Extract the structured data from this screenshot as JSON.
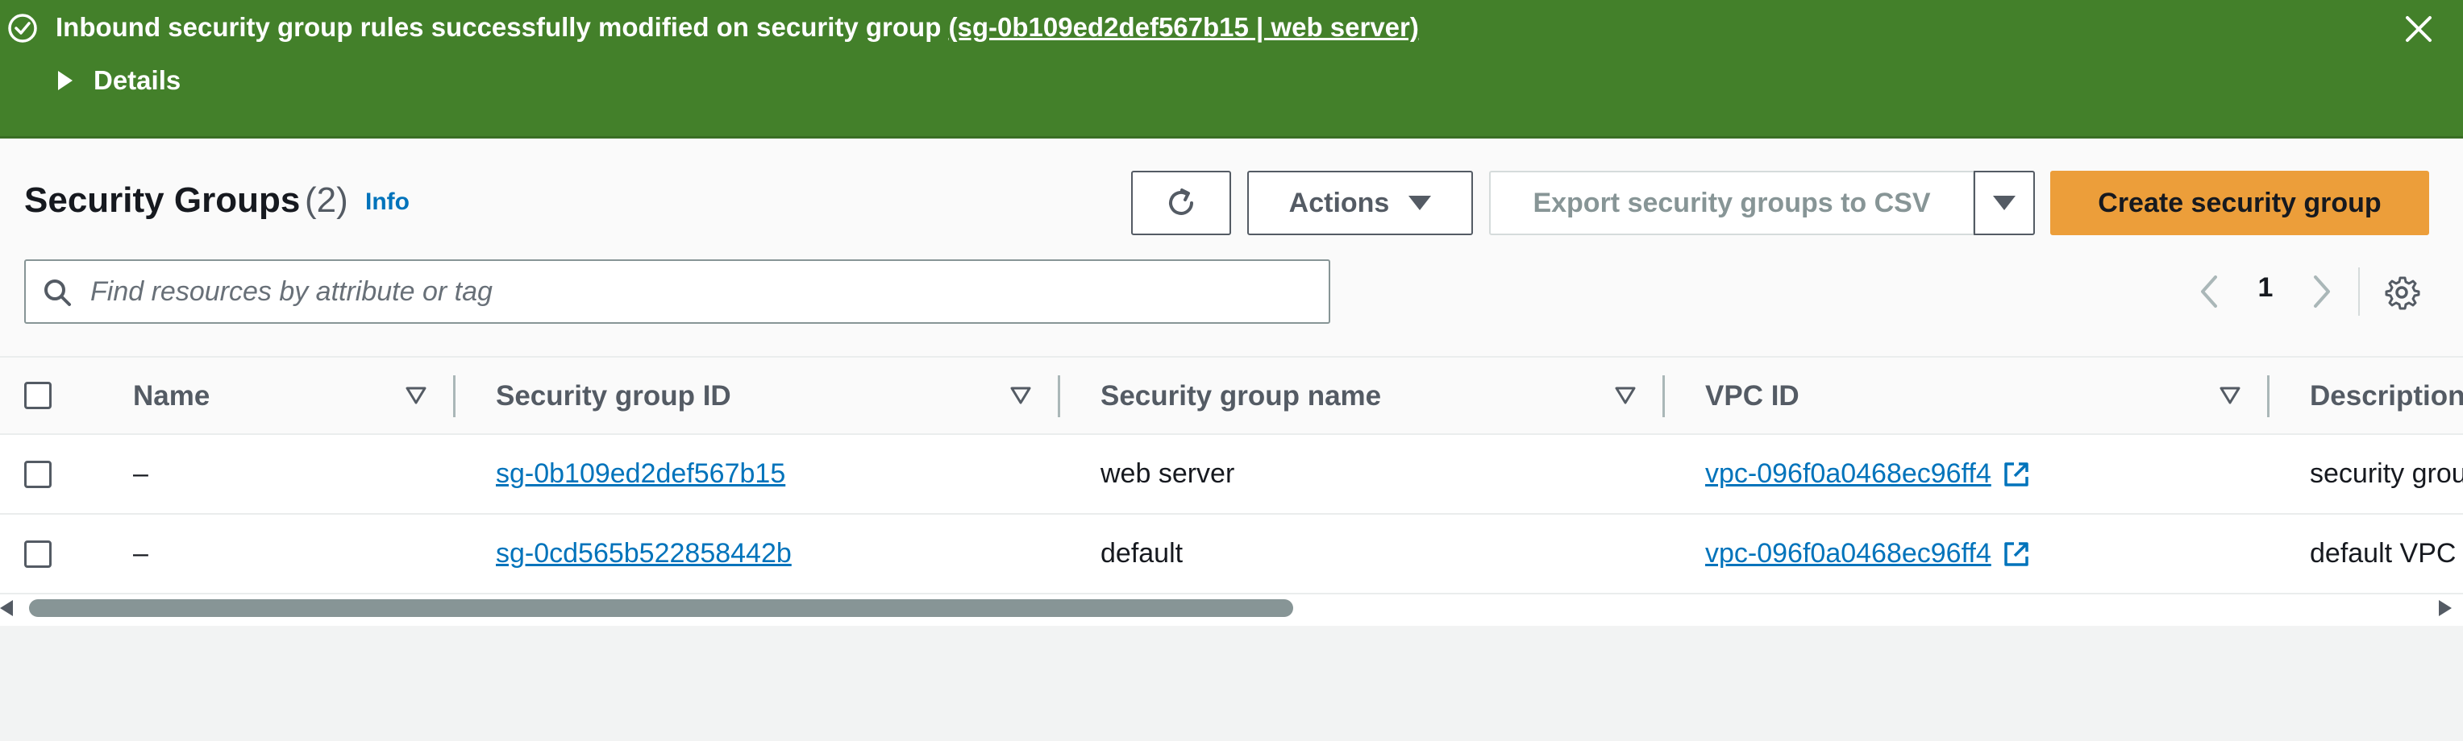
{
  "flash": {
    "message_prefix": "Inbound security group rules successfully modified on security group ",
    "message_link": "(sg-0b109ed2def567b15 | web server)",
    "details_label": "Details",
    "color": "#43802a"
  },
  "header": {
    "title": "Security Groups",
    "count": "(2)",
    "info_label": "Info",
    "actions_label": "Actions",
    "export_label": "Export security groups to CSV",
    "create_label": "Create security group",
    "create_color": "#ec9e3a"
  },
  "search": {
    "placeholder": "Find resources by attribute or tag",
    "value": ""
  },
  "pagination": {
    "current_page": "1"
  },
  "table": {
    "columns": [
      "Name",
      "Security group ID",
      "Security group name",
      "VPC ID",
      "Description"
    ],
    "rows": [
      {
        "name": "–",
        "sg_id": "sg-0b109ed2def567b15",
        "sg_name": "web server",
        "vpc_id": "vpc-096f0a0468ec96ff4",
        "description": "security grou"
      },
      {
        "name": "–",
        "sg_id": "sg-0cd565b522858442b",
        "sg_name": "default",
        "vpc_id": "vpc-096f0a0468ec96ff4",
        "description": "default VPC"
      }
    ]
  },
  "colors": {
    "link": "#0073bb",
    "text": "#16191f",
    "muted": "#545b64"
  }
}
